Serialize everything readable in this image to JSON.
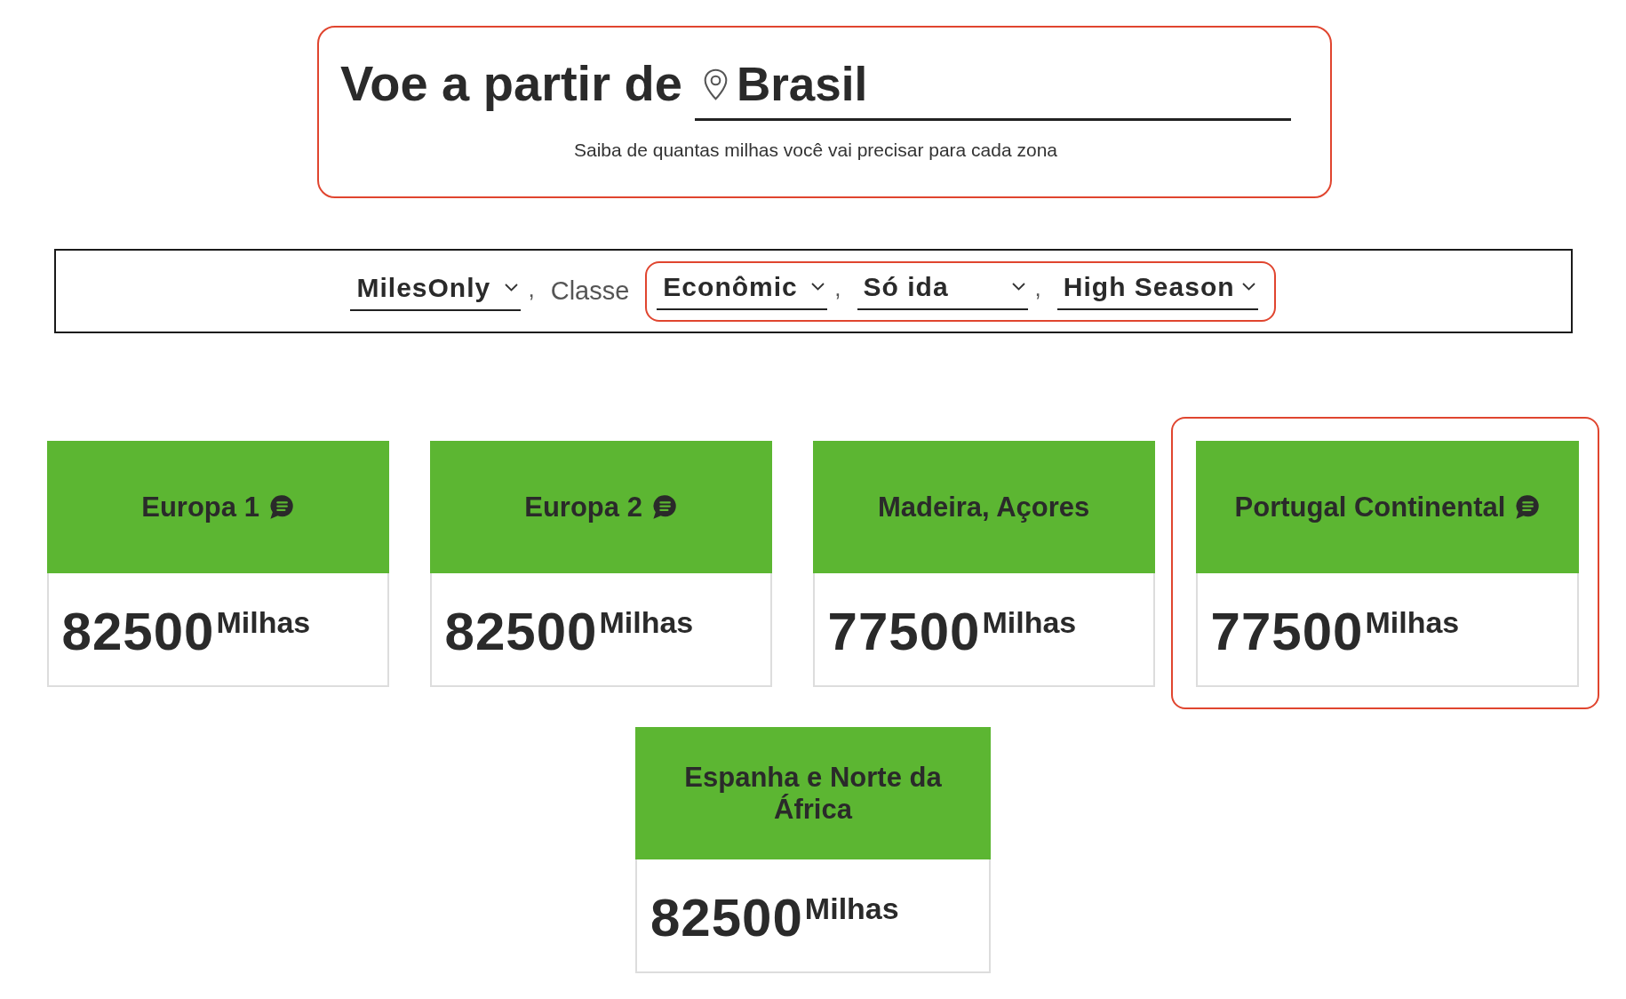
{
  "header": {
    "title": "Voe a partir de",
    "location": {
      "value": "Brasil"
    },
    "subtitle": "Saiba de quantas milhas você vai precisar para cada zona",
    "highlighted": true
  },
  "filters": [
    {
      "kind": "select",
      "value": "MilesOnly",
      "highlighted": false,
      "separator": ","
    },
    {
      "kind": "label",
      "text": "Classe",
      "highlighted": false
    },
    {
      "kind": "select",
      "value": "Econômic",
      "highlighted": true,
      "separator": ","
    },
    {
      "kind": "select",
      "value": "Só ida",
      "highlighted": true,
      "separator": ","
    },
    {
      "kind": "select",
      "value": "High Season",
      "highlighted": true
    }
  ],
  "zones": [
    {
      "name": "Europa 1",
      "info": true,
      "miles": "82500",
      "unit": "Milhas",
      "highlighted": false
    },
    {
      "name": "Europa 2",
      "info": true,
      "miles": "82500",
      "unit": "Milhas",
      "highlighted": false
    },
    {
      "name": "Madeira, Açores",
      "info": false,
      "miles": "77500",
      "unit": "Milhas",
      "highlighted": false
    },
    {
      "name": "Portugal Continental",
      "info": true,
      "miles": "77500",
      "unit": "Milhas",
      "highlighted": true
    },
    {
      "name": "Espanha e Norte da África",
      "info": false,
      "miles": "82500",
      "unit": "Milhas",
      "highlighted": false
    }
  ]
}
